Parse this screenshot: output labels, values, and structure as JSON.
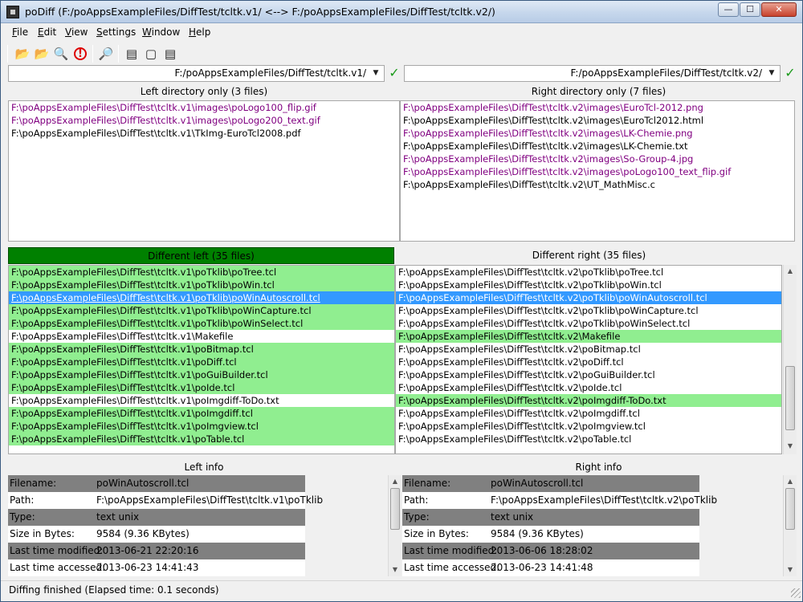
{
  "window": {
    "title": "poDiff (F:/poAppsExampleFiles/DiffTest/tcltk.v1/ <--> F:/poAppsExampleFiles/DiffTest/tcltk.v2/)",
    "minimize_glyph": "—",
    "maximize_glyph": "☐",
    "close_glyph": "✕"
  },
  "menu": {
    "items": [
      {
        "first": "F",
        "rest": "ile"
      },
      {
        "first": "E",
        "rest": "dit"
      },
      {
        "first": "V",
        "rest": "iew"
      },
      {
        "first": "S",
        "rest": "ettings"
      },
      {
        "first": "W",
        "rest": "indow"
      },
      {
        "first": "H",
        "rest": "elp"
      }
    ]
  },
  "toolbar": {
    "icons": [
      "open-left-icon",
      "open-right-icon",
      "preview-icon",
      "stop-icon",
      "search-icon",
      "diff-icon",
      "file-icon",
      "file-text-icon"
    ],
    "glyphs": [
      "📂",
      "📂",
      "🔍",
      "!",
      "🔎",
      "▤",
      "▢",
      "▤"
    ]
  },
  "paths": {
    "left": "F:/poAppsExampleFiles/DiffTest/tcltk.v1/",
    "right": "F:/poAppsExampleFiles/DiffTest/tcltk.v2/",
    "dropdown_glyph": "▼",
    "check_glyph": "✓"
  },
  "left_only": {
    "header": "Left directory only (3 files)",
    "rows": [
      {
        "text": "F:\\poAppsExampleFiles\\DiffTest\\tcltk.v1\\images\\poLogo100_flip.gif",
        "style": "purple"
      },
      {
        "text": "F:\\poAppsExampleFiles\\DiffTest\\tcltk.v1\\images\\poLogo200_text.gif",
        "style": "purple"
      },
      {
        "text": "F:\\poAppsExampleFiles\\DiffTest\\tcltk.v1\\TkImg-EuroTcl2008.pdf",
        "style": "normal"
      }
    ]
  },
  "right_only": {
    "header": "Right directory only (7 files)",
    "rows": [
      {
        "text": "F:\\poAppsExampleFiles\\DiffTest\\tcltk.v2\\images\\EuroTcl-2012.png",
        "style": "purple"
      },
      {
        "text": "F:\\poAppsExampleFiles\\DiffTest\\tcltk.v2\\images\\EuroTcl2012.html",
        "style": "normal"
      },
      {
        "text": "F:\\poAppsExampleFiles\\DiffTest\\tcltk.v2\\images\\LK-Chemie.png",
        "style": "purple"
      },
      {
        "text": "F:\\poAppsExampleFiles\\DiffTest\\tcltk.v2\\images\\LK-Chemie.txt",
        "style": "normal"
      },
      {
        "text": "F:\\poAppsExampleFiles\\DiffTest\\tcltk.v2\\images\\So-Group-4.jpg",
        "style": "purple"
      },
      {
        "text": "F:\\poAppsExampleFiles\\DiffTest\\tcltk.v2\\images\\poLogo100_text_flip.gif",
        "style": "purple"
      },
      {
        "text": "F:\\poAppsExampleFiles\\DiffTest\\tcltk.v2\\UT_MathMisc.c",
        "style": "normal"
      }
    ]
  },
  "diff_left": {
    "header": "Different left (35 files)",
    "rows": [
      {
        "text": "F:\\poAppsExampleFiles\\DiffTest\\tcltk.v1\\poTklib\\poTree.tcl",
        "style": "green"
      },
      {
        "text": "F:\\poAppsExampleFiles\\DiffTest\\tcltk.v1\\poTklib\\poWin.tcl",
        "style": "green"
      },
      {
        "text": "F:\\poAppsExampleFiles\\DiffTest\\tcltk.v1\\poTklib\\poWinAutoscroll.tcl",
        "style": "selected-ul"
      },
      {
        "text": "F:\\poAppsExampleFiles\\DiffTest\\tcltk.v1\\poTklib\\poWinCapture.tcl",
        "style": "green"
      },
      {
        "text": "F:\\poAppsExampleFiles\\DiffTest\\tcltk.v1\\poTklib\\poWinSelect.tcl",
        "style": "green"
      },
      {
        "text": "F:\\poAppsExampleFiles\\DiffTest\\tcltk.v1\\Makefile",
        "style": "normal"
      },
      {
        "text": "F:\\poAppsExampleFiles\\DiffTest\\tcltk.v1\\poBitmap.tcl",
        "style": "green"
      },
      {
        "text": "F:\\poAppsExampleFiles\\DiffTest\\tcltk.v1\\poDiff.tcl",
        "style": "green"
      },
      {
        "text": "F:\\poAppsExampleFiles\\DiffTest\\tcltk.v1\\poGuiBuilder.tcl",
        "style": "green"
      },
      {
        "text": "F:\\poAppsExampleFiles\\DiffTest\\tcltk.v1\\poIde.tcl",
        "style": "green"
      },
      {
        "text": "F:\\poAppsExampleFiles\\DiffTest\\tcltk.v1\\poImgdiff-ToDo.txt",
        "style": "normal"
      },
      {
        "text": "F:\\poAppsExampleFiles\\DiffTest\\tcltk.v1\\poImgdiff.tcl",
        "style": "green"
      },
      {
        "text": "F:\\poAppsExampleFiles\\DiffTest\\tcltk.v1\\poImgview.tcl",
        "style": "green"
      },
      {
        "text": "F:\\poAppsExampleFiles\\DiffTest\\tcltk.v1\\poTable.tcl",
        "style": "green"
      }
    ]
  },
  "diff_right": {
    "header": "Different right (35 files)",
    "rows": [
      {
        "text": "F:\\poAppsExampleFiles\\DiffTest\\tcltk.v2\\poTklib\\poTree.tcl",
        "style": "normal"
      },
      {
        "text": "F:\\poAppsExampleFiles\\DiffTest\\tcltk.v2\\poTklib\\poWin.tcl",
        "style": "normal"
      },
      {
        "text": "F:\\poAppsExampleFiles\\DiffTest\\tcltk.v2\\poTklib\\poWinAutoscroll.tcl",
        "style": "selected"
      },
      {
        "text": "F:\\poAppsExampleFiles\\DiffTest\\tcltk.v2\\poTklib\\poWinCapture.tcl",
        "style": "normal"
      },
      {
        "text": "F:\\poAppsExampleFiles\\DiffTest\\tcltk.v2\\poTklib\\poWinSelect.tcl",
        "style": "normal"
      },
      {
        "text": "F:\\poAppsExampleFiles\\DiffTest\\tcltk.v2\\Makefile",
        "style": "green"
      },
      {
        "text": "F:\\poAppsExampleFiles\\DiffTest\\tcltk.v2\\poBitmap.tcl",
        "style": "normal"
      },
      {
        "text": "F:\\poAppsExampleFiles\\DiffTest\\tcltk.v2\\poDiff.tcl",
        "style": "normal"
      },
      {
        "text": "F:\\poAppsExampleFiles\\DiffTest\\tcltk.v2\\poGuiBuilder.tcl",
        "style": "normal"
      },
      {
        "text": "F:\\poAppsExampleFiles\\DiffTest\\tcltk.v2\\poIde.tcl",
        "style": "normal"
      },
      {
        "text": "F:\\poAppsExampleFiles\\DiffTest\\tcltk.v2\\poImgdiff-ToDo.txt",
        "style": "green"
      },
      {
        "text": "F:\\poAppsExampleFiles\\DiffTest\\tcltk.v2\\poImgdiff.tcl",
        "style": "normal"
      },
      {
        "text": "F:\\poAppsExampleFiles\\DiffTest\\tcltk.v2\\poImgview.tcl",
        "style": "normal"
      },
      {
        "text": "F:\\poAppsExampleFiles\\DiffTest\\tcltk.v2\\poTable.tcl",
        "style": "normal"
      }
    ]
  },
  "left_info": {
    "header": "Left info",
    "rows": [
      {
        "key": "Filename:",
        "value": "poWinAutoscroll.tcl"
      },
      {
        "key": "Path:",
        "value": "F:\\poAppsExampleFiles\\DiffTest\\tcltk.v1\\poTklib"
      },
      {
        "key": "Type:",
        "value": "text unix"
      },
      {
        "key": "Size in Bytes:",
        "value": "9584 (9.36 KBytes)"
      },
      {
        "key": "Last time modified:",
        "value": "2013-06-21 22:20:16"
      },
      {
        "key": "Last time accessed:",
        "value": "2013-06-23 14:41:43"
      }
    ]
  },
  "right_info": {
    "header": "Right info",
    "rows": [
      {
        "key": "Filename:",
        "value": "poWinAutoscroll.tcl"
      },
      {
        "key": "Path:",
        "value": "F:\\poAppsExampleFiles\\DiffTest\\tcltk.v2\\poTklib"
      },
      {
        "key": "Type:",
        "value": "text unix"
      },
      {
        "key": "Size in Bytes:",
        "value": "9584 (9.36 KBytes)"
      },
      {
        "key": "Last time modified:",
        "value": "2013-06-06 18:28:02"
      },
      {
        "key": "Last time accessed:",
        "value": "2013-06-23 14:41:48"
      }
    ]
  },
  "status": {
    "text": "Diffing finished (Elapsed time:  0.1 seconds)"
  },
  "colors": {
    "match_green": "#90ee90",
    "header_green": "#008000",
    "selection_blue": "#3399ff",
    "only_purple": "#800080",
    "info_gray": "#808080"
  }
}
